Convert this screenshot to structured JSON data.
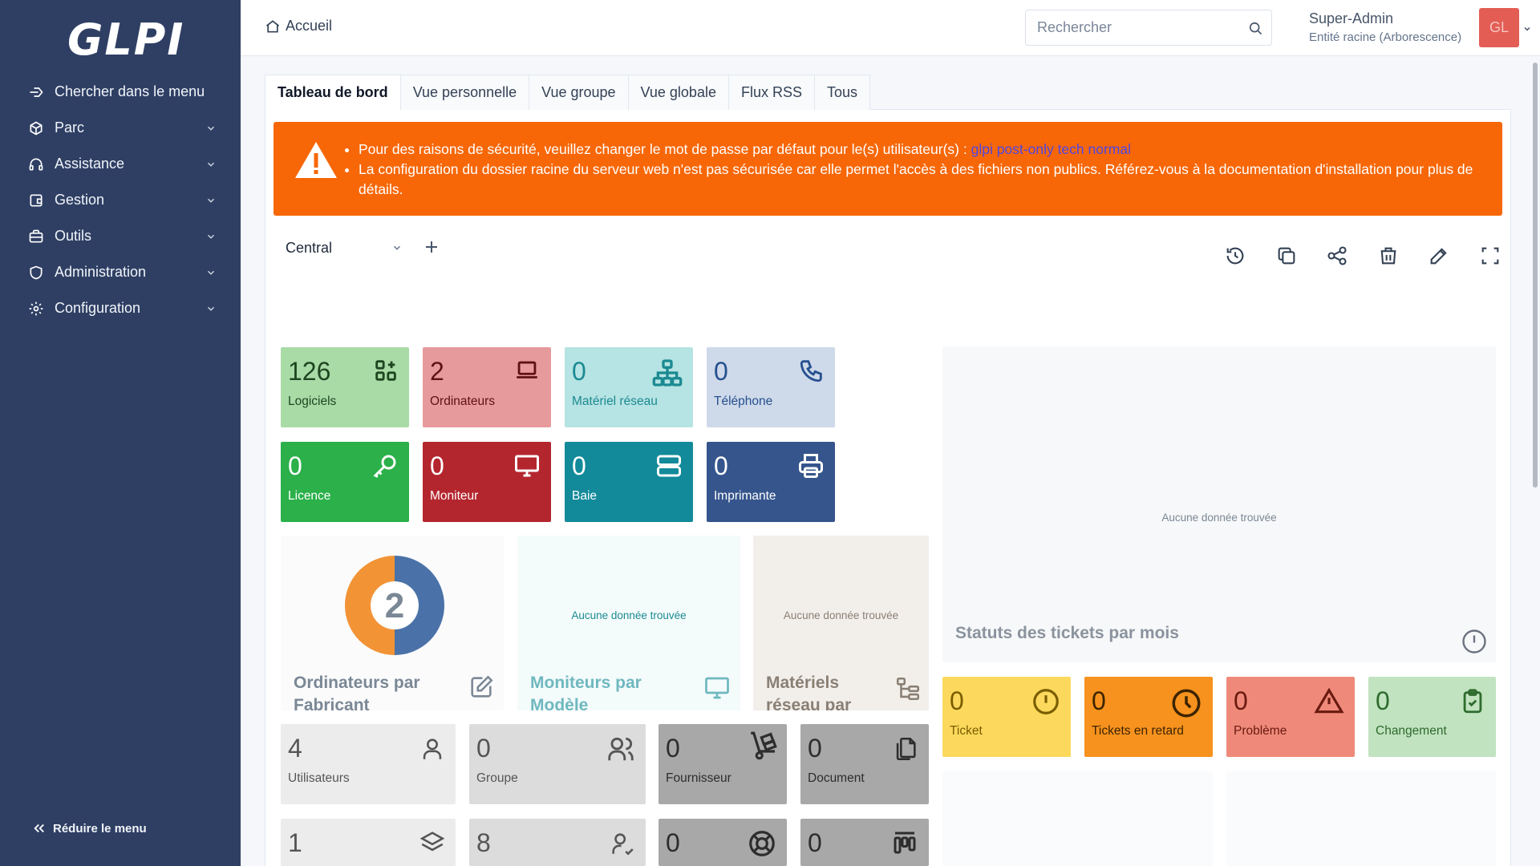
{
  "app": {
    "logo": "GLPI"
  },
  "sidebar": {
    "items": [
      {
        "label": "Chercher dans le menu",
        "icon": "search-menu-icon",
        "caret": false
      },
      {
        "label": "Parc",
        "icon": "box-icon",
        "caret": true
      },
      {
        "label": "Assistance",
        "icon": "headset-icon",
        "caret": true
      },
      {
        "label": "Gestion",
        "icon": "wallet-icon",
        "caret": true
      },
      {
        "label": "Outils",
        "icon": "briefcase-icon",
        "caret": true
      },
      {
        "label": "Administration",
        "icon": "shield-icon",
        "caret": true
      },
      {
        "label": "Configuration",
        "icon": "gear-icon",
        "caret": true
      }
    ],
    "collapse_label": "Réduire le menu"
  },
  "header": {
    "breadcrumb": "Accueil",
    "search_placeholder": "Rechercher",
    "user_name": "Super-Admin",
    "user_entity": "Entité racine (Arborescence)",
    "avatar_initials": "GL"
  },
  "tabs": [
    {
      "label": "Tableau de bord",
      "active": true
    },
    {
      "label": "Vue personnelle",
      "active": false
    },
    {
      "label": "Vue groupe",
      "active": false
    },
    {
      "label": "Vue globale",
      "active": false
    },
    {
      "label": "Flux RSS",
      "active": false
    },
    {
      "label": "Tous",
      "active": false
    }
  ],
  "alert": {
    "line1_text": "Pour des raisons de sécurité, veuillez changer le mot de passe par défaut pour le(s) utilisateur(s) :",
    "line1_users": "glpi post-only tech normal",
    "line2_text": "La configuration du dossier racine du serveur web n'est pas sécurisée car elle permet l'accès à des fichiers non publics. Référez-vous à la documentation d'installation pour plus de détails.",
    "color": "#f76707"
  },
  "dashboard": {
    "selected": "Central"
  },
  "cards": {
    "logiciels": {
      "value": "126",
      "label": "Logiciels",
      "bg": "#a9dba7",
      "fg": "#1e4620"
    },
    "ordinateurs": {
      "value": "2",
      "label": "Ordinateurs",
      "bg": "#e79a9c",
      "fg": "#5e1214"
    },
    "materiel_reseau": {
      "value": "0",
      "label": "Matériel réseau",
      "bg": "#b6e3e3",
      "fg": "#1b8a92"
    },
    "telephone": {
      "value": "0",
      "label": "Téléphone",
      "bg": "#ced9e9",
      "fg": "#26508f"
    },
    "licence": {
      "value": "0",
      "label": "Licence",
      "bg": "#2bb04a",
      "fg": "#ffffff"
    },
    "moniteur": {
      "value": "0",
      "label": "Moniteur",
      "bg": "#b4262e",
      "fg": "#ffffff"
    },
    "baie": {
      "value": "0",
      "label": "Baie",
      "bg": "#128a9a",
      "fg": "#ffffff"
    },
    "imprimante": {
      "value": "0",
      "label": "Imprimante",
      "bg": "#35558c",
      "fg": "#ffffff"
    },
    "utilisateurs": {
      "value": "4",
      "label": "Utilisateurs",
      "bg": "#ececec",
      "fg": "#555555"
    },
    "groupe": {
      "value": "0",
      "label": "Groupe",
      "bg": "#dcdcdc",
      "fg": "#555555"
    },
    "fournisseur": {
      "value": "0",
      "label": "Fournisseur",
      "bg": "#a8a8a8",
      "fg": "#2d2d2d"
    },
    "document": {
      "value": "0",
      "label": "Document",
      "bg": "#a8a8a8",
      "fg": "#2d2d2d"
    },
    "row4_a": {
      "value": "1"
    },
    "row4_b": {
      "value": "8"
    },
    "row4_c": {
      "value": "0"
    },
    "row4_d": {
      "value": "0"
    },
    "ticket": {
      "value": "0",
      "label": "Ticket",
      "bg": "#fcd95d",
      "fg": "#7a5d00"
    },
    "tickets_retard": {
      "value": "0",
      "label": "Tickets en retard",
      "bg": "#f7921e",
      "fg": "#3d2400"
    },
    "probleme": {
      "value": "0",
      "label": "Problème",
      "bg": "#ef8a7b",
      "fg": "#6a1a0f"
    },
    "changement": {
      "value": "0",
      "label": "Changement",
      "bg": "#c1e3c0",
      "fg": "#2f6b2d"
    }
  },
  "widgets": {
    "ordinateurs_fabricant": {
      "title": "Ordinateurs par Fabricant",
      "donut_value": "2",
      "colors": [
        "#4a72a8",
        "#f29336"
      ]
    },
    "moniteurs_modele": {
      "title": "Moniteurs par Modèle",
      "nodata": "Aucune donnée trouvée"
    },
    "materiels_reseau": {
      "title": "Matériels réseau par",
      "nodata": "Aucune donnée trouvée"
    },
    "statuts_tickets": {
      "title": "Statuts des tickets par mois",
      "nodata": "Aucune donnée trouvée"
    }
  }
}
